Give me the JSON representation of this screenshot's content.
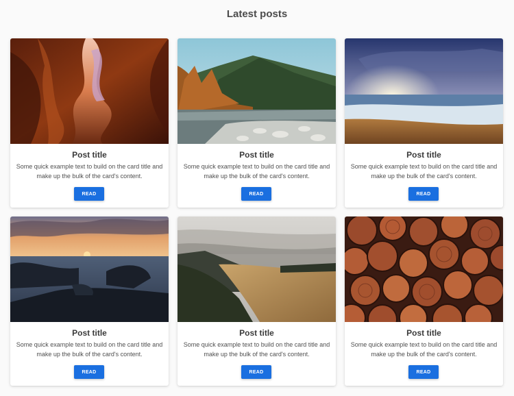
{
  "header": {
    "title": "Latest posts"
  },
  "colors": {
    "accent": "#1a6fe0",
    "background": "#fafafa",
    "card": "#ffffff"
  },
  "posts": [
    {
      "image": "canyon-photo",
      "title": "Post title",
      "text": "Some quick example text to build on the card title and make up the bulk of the card's content.",
      "button": "READ"
    },
    {
      "image": "mountain-river-photo",
      "title": "Post title",
      "text": "Some quick example text to build on the card title and make up the bulk of the card's content.",
      "button": "READ"
    },
    {
      "image": "beach-sunset-photo",
      "title": "Post title",
      "text": "Some quick example text to build on the card title and make up the bulk of the card's content.",
      "button": "READ"
    },
    {
      "image": "rocky-shore-sunset-photo",
      "title": "Post title",
      "text": "Some quick example text to build on the card title and make up the bulk of the card's content.",
      "button": "READ"
    },
    {
      "image": "misty-hills-photo",
      "title": "Post title",
      "text": "Some quick example text to build on the card title and make up the bulk of the card's content.",
      "button": "READ"
    },
    {
      "image": "firewood-logs-photo",
      "title": "Post title",
      "text": "Some quick example text to build on the card title and make up the bulk of the card's content.",
      "button": "READ"
    }
  ]
}
